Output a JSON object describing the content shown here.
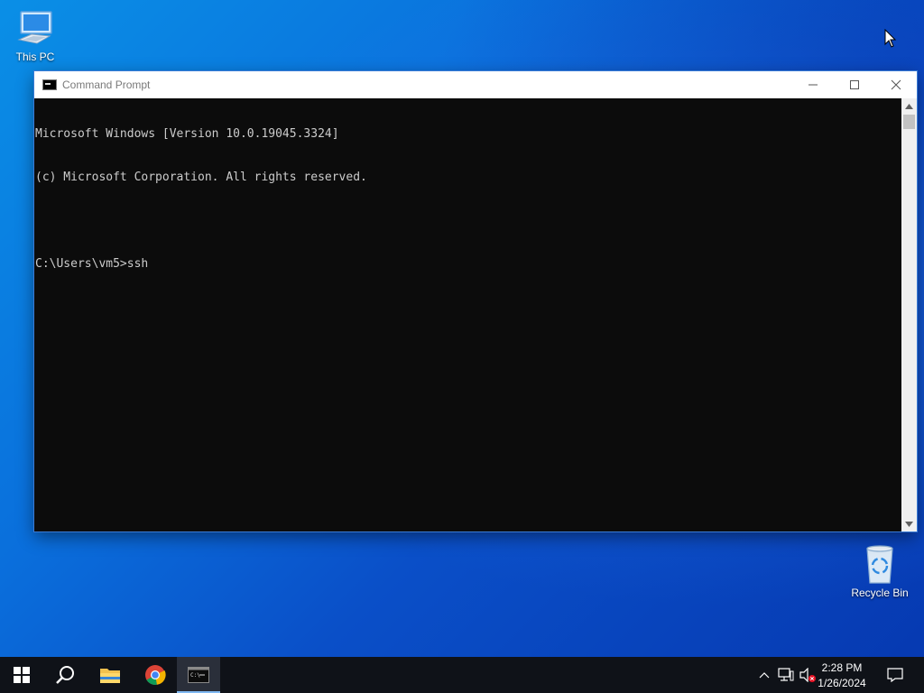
{
  "desktop": {
    "icons": [
      {
        "label": "This PC",
        "icon": "this-pc-icon"
      },
      {
        "label": "Recycle Bin",
        "icon": "recycle-bin-icon"
      }
    ]
  },
  "window": {
    "title": "Command Prompt",
    "icon": "cmd-icon",
    "controls": {
      "minimize": "minimize-icon",
      "maximize": "maximize-icon",
      "close": "close-icon"
    },
    "console_lines": [
      "Microsoft Windows [Version 10.0.19045.3324]",
      "(c) Microsoft Corporation. All rights reserved.",
      "",
      "C:\\Users\\vm5>ssh"
    ]
  },
  "taskbar": {
    "buttons": [
      {
        "name": "start",
        "icon": "windows-logo-icon"
      },
      {
        "name": "search",
        "icon": "search-icon"
      },
      {
        "name": "file-explorer",
        "icon": "folder-icon"
      },
      {
        "name": "chrome",
        "icon": "chrome-icon"
      },
      {
        "name": "command-prompt",
        "icon": "cmd-icon",
        "active": true
      }
    ],
    "tray": {
      "icons": [
        "chevron-up-icon",
        "network-icon",
        "volume-muted-icon",
        "notification-icon"
      ],
      "time": "2:28 PM",
      "date": "1/26/2024"
    }
  },
  "colors": {
    "console_bg": "#0c0c0c",
    "console_text": "#cccccc",
    "taskbar_bg": "#0f1218",
    "active_indicator": "#7fb8f2"
  }
}
